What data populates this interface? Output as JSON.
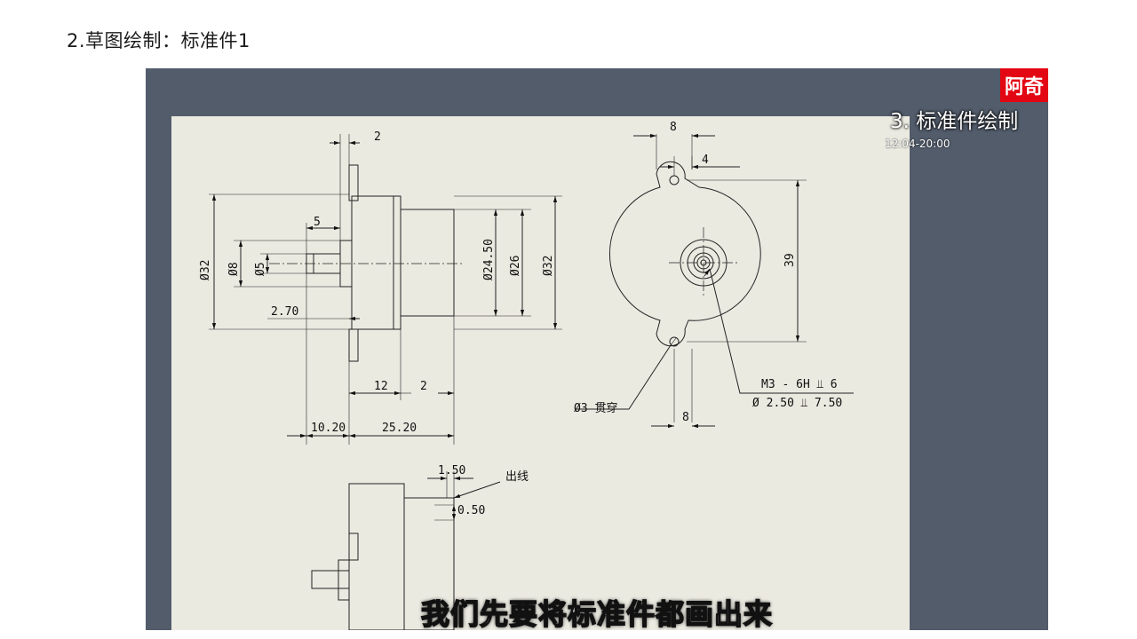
{
  "slide": {
    "title": "2.草图绘制：标准件1"
  },
  "video": {
    "badge_text": "阿奇",
    "episode_title": "3. 标准件绘制",
    "timestamp": "12:04-20:00",
    "subtitle": "我们先要将标准件都画出来",
    "colors": {
      "background": "#525c6b",
      "sheet": "#ebeae1",
      "badge": "#e30613"
    }
  },
  "drawing": {
    "front_view": {
      "dim_top": "2",
      "dim_shaft_len": "5",
      "dia_outer_left": "Ø32",
      "dia_8": "Ø8",
      "dia_5": "Ø5",
      "dia_24_50": "Ø24.50",
      "dia_26": "Ø26",
      "dia_outer_right": "Ø32",
      "dim_2_70": "2.70",
      "dim_12": "12",
      "dim_2_bottom": "2",
      "dim_10_20": "10.20",
      "dim_25_20": "25.20"
    },
    "side_view": {
      "dim_8_top": "8",
      "dim_4": "4",
      "dim_39": "39",
      "thread_note_1": "M3 - 6H ⫫ 6",
      "thread_note_2": "Ø 2.50 ⫫ 7.50",
      "hole_note": "Ø3 贯穿",
      "dim_8_bottom": "8"
    },
    "detail_view": {
      "dim_1_50": "1.50",
      "wire_label": "出线",
      "dim_0_50": "0.50"
    }
  }
}
